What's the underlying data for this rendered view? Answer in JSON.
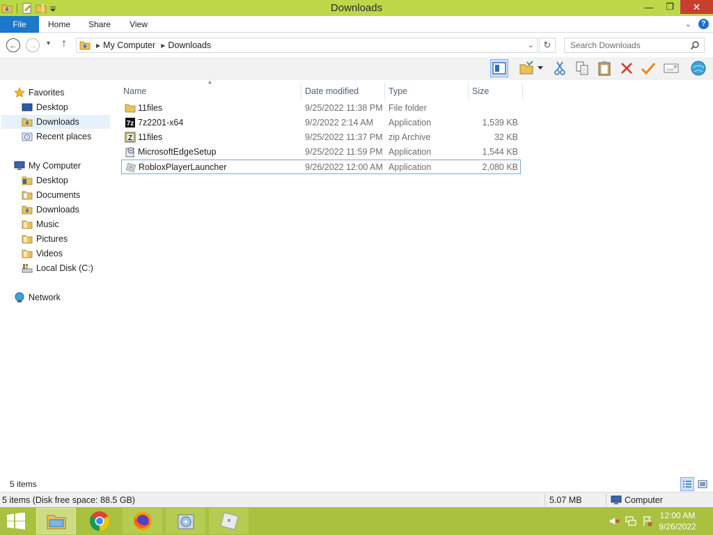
{
  "window": {
    "title": "Downloads",
    "minimize_glyph": "—",
    "maximize_glyph": "❐",
    "close_glyph": "✕"
  },
  "ribbon": {
    "tabs": [
      {
        "label": "File"
      },
      {
        "label": "Home"
      },
      {
        "label": "Share"
      },
      {
        "label": "View"
      }
    ],
    "help_glyph": "?",
    "collapse_glyph": "⌄"
  },
  "navigation": {
    "back_glyph": "←",
    "forward_glyph": "→",
    "recent_glyph": "▾",
    "up_glyph": "↑",
    "breadcrumb": [
      "My Computer",
      "Downloads"
    ],
    "refresh_glyph": "↻",
    "search_placeholder": "Search Downloads"
  },
  "sidebar": {
    "favorites": {
      "label": "Favorites",
      "items": [
        {
          "label": "Desktop",
          "icon": "desktop-icon"
        },
        {
          "label": "Downloads",
          "icon": "downloads-folder-icon",
          "selected": true
        },
        {
          "label": "Recent places",
          "icon": "recent-places-icon"
        }
      ]
    },
    "computer": {
      "label": "My Computer",
      "items": [
        {
          "label": "Desktop",
          "icon": "folder-icon"
        },
        {
          "label": "Documents",
          "icon": "folder-icon"
        },
        {
          "label": "Downloads",
          "icon": "folder-icon"
        },
        {
          "label": "Music",
          "icon": "folder-icon"
        },
        {
          "label": "Pictures",
          "icon": "folder-icon"
        },
        {
          "label": "Videos",
          "icon": "folder-icon"
        },
        {
          "label": "Local Disk (C:)",
          "icon": "drive-icon"
        }
      ]
    },
    "network": {
      "label": "Network"
    }
  },
  "file_list": {
    "columns": {
      "name": "Name",
      "date": "Date modified",
      "type": "Type",
      "size": "Size"
    },
    "rows": [
      {
        "name": "11files",
        "date": "9/25/2022 11:38 PM",
        "type": "File folder",
        "size": "",
        "icon": "folder-icon"
      },
      {
        "name": "7z2201-x64",
        "date": "9/2/2022 2:14 AM",
        "type": "Application",
        "size": "1,539 KB",
        "icon": "7zip-icon"
      },
      {
        "name": "11files",
        "date": "9/25/2022 11:37 PM",
        "type": "zip Archive",
        "size": "32 KB",
        "icon": "zip-archive-icon"
      },
      {
        "name": "MicrosoftEdgeSetup",
        "date": "9/25/2022 11:59 PM",
        "type": "Application",
        "size": "1,544 KB",
        "icon": "installer-icon"
      },
      {
        "name": "RobloxPlayerLauncher",
        "date": "9/26/2022 12:00 AM",
        "type": "Application",
        "size": "2,080 KB",
        "icon": "roblox-icon",
        "selected": true
      }
    ]
  },
  "status": {
    "item_count": "5 items",
    "details": "5 items (Disk free space: 88.5 GB)",
    "size": "5.07 MB",
    "location": "Computer"
  },
  "taskbar": {
    "time": "12:00 AM",
    "date": "9/26/2022"
  },
  "colors": {
    "titlebar": "#bcd848",
    "taskbar": "#a8c13f",
    "file_tab": "#1979ca",
    "close_button": "#c7402c",
    "selection": "#e5f1fb"
  }
}
